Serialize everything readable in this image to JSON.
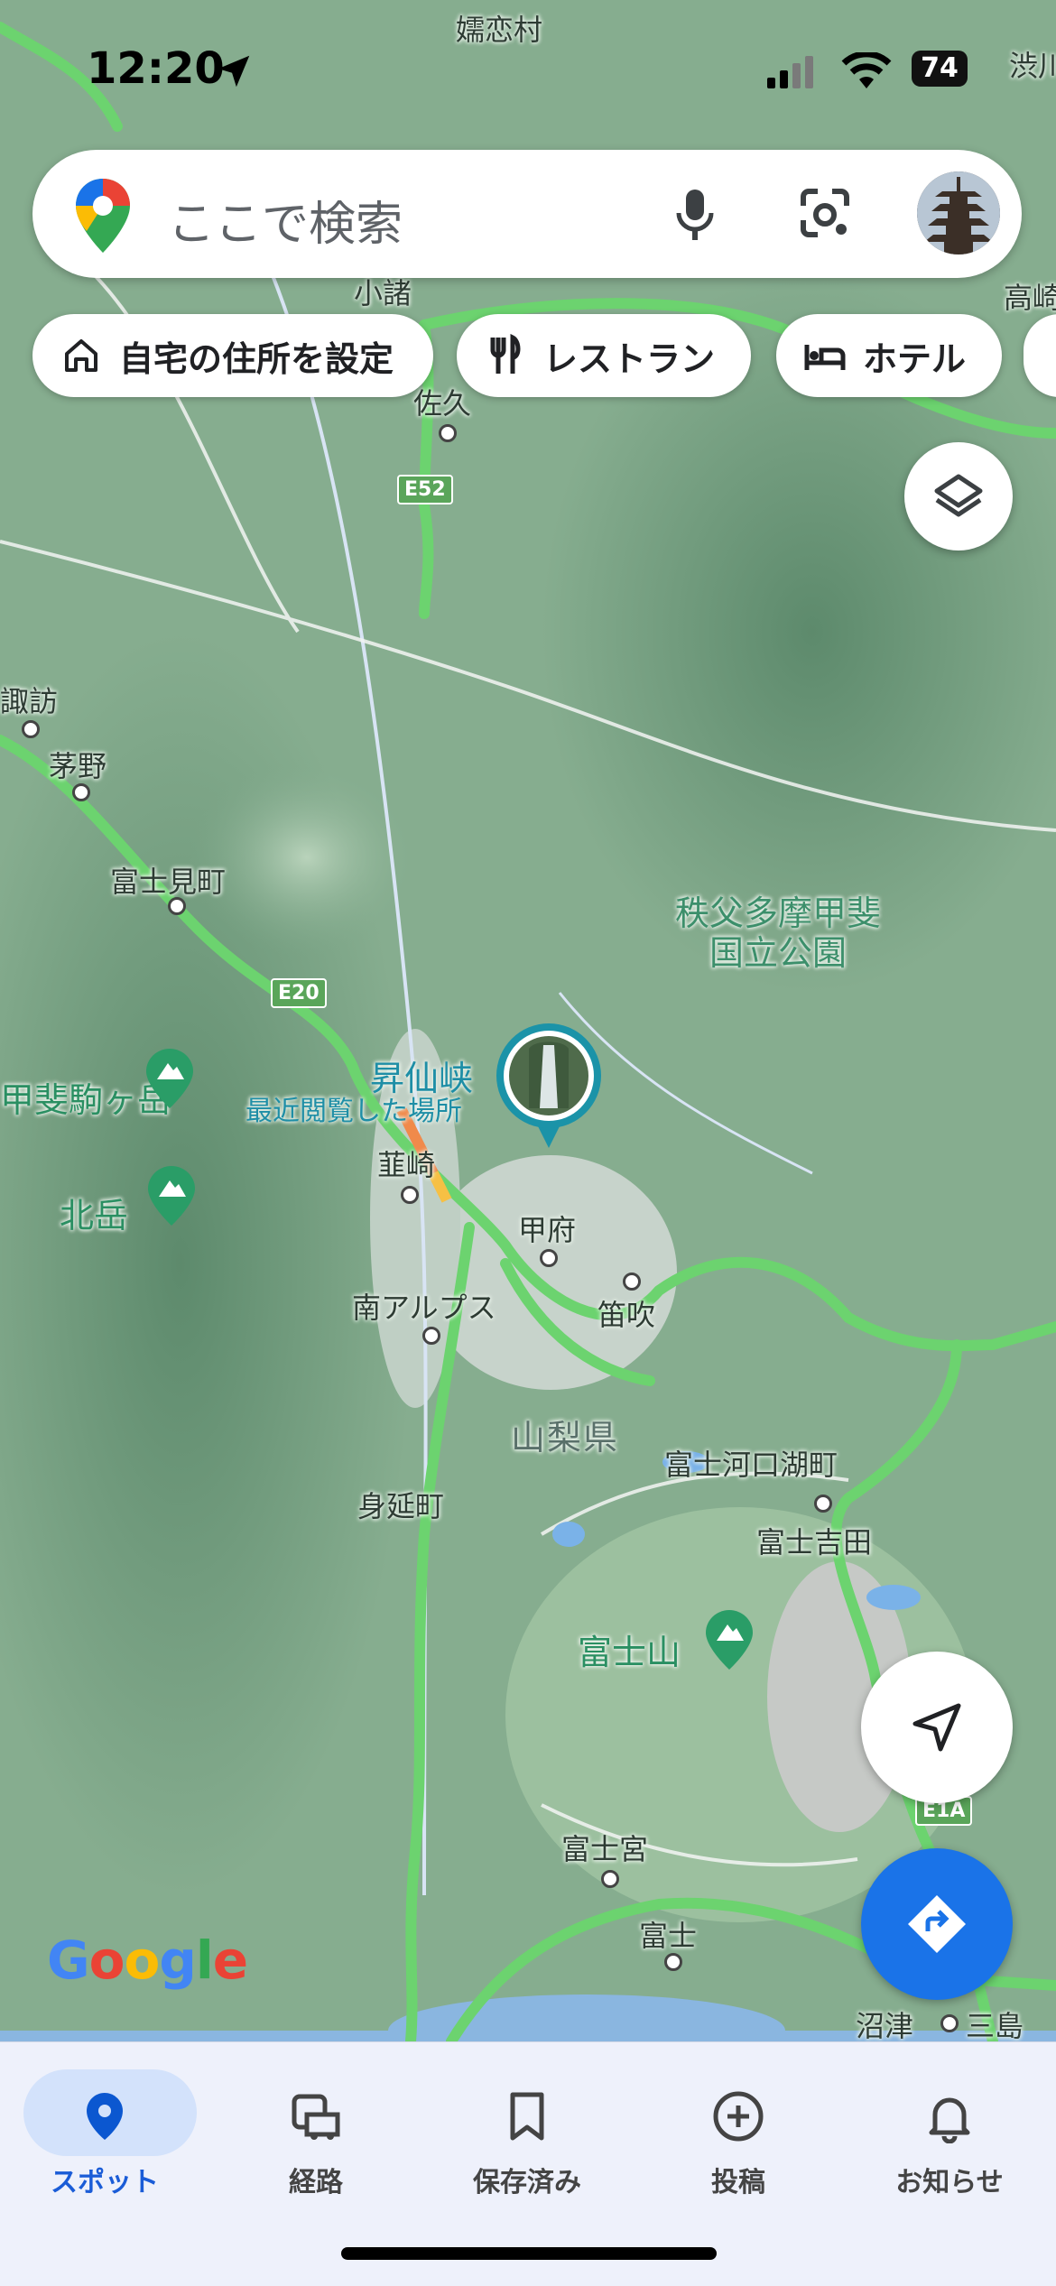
{
  "status_bar": {
    "time": "12:20",
    "battery": "74"
  },
  "search": {
    "placeholder": "ここで検索"
  },
  "chips": [
    {
      "label": "自宅の住所を設定",
      "icon": "home-icon"
    },
    {
      "label": "レストラン",
      "icon": "restaurant-icon"
    },
    {
      "label": "ホテル",
      "icon": "hotel-icon"
    }
  ],
  "map": {
    "labels": {
      "kurokomura": "嬬恋村",
      "shibu": "渋川",
      "komoro": "小諸",
      "saku": "佐久",
      "takasaki": "高崎",
      "suwa": "諏訪",
      "chino": "茅野",
      "fujimi": "富士見町",
      "park": "秩父多摩甲斐\n国立公園",
      "komagatake": "甲斐駒ヶ岳",
      "kitadake": "北岳",
      "shosenkyo": "昇仙峡",
      "recent": "最近閲覧した場所",
      "nirasaki": "韮崎",
      "kofu": "甲府",
      "minami_alps": "南アルプス",
      "fuefuki": "笛吹",
      "yamanashi": "山梨県",
      "fujikawaguchiko": "富士河口湖町",
      "fujiyoshida": "富士吉田",
      "minobu": "身延町",
      "fujisan": "富士山",
      "fujinomiya": "富士宮",
      "fuji": "富士",
      "numazu": "沼津",
      "mishima": "三島"
    },
    "shields": {
      "e52": "E52",
      "e20": "E20",
      "e1a": "E1A"
    },
    "attribution": "Google"
  },
  "bottom_nav": [
    {
      "label": "スポット",
      "icon": "location-pin-icon",
      "active": true
    },
    {
      "label": "経路",
      "icon": "commute-icon",
      "active": false
    },
    {
      "label": "保存済み",
      "icon": "bookmark-icon",
      "active": false
    },
    {
      "label": "投稿",
      "icon": "add-circle-icon",
      "active": false
    },
    {
      "label": "お知らせ",
      "icon": "bell-icon",
      "active": false
    }
  ],
  "colors": {
    "accent": "#1a73e8",
    "highway": "#6cd36f",
    "terrain": "#7fa88a"
  }
}
